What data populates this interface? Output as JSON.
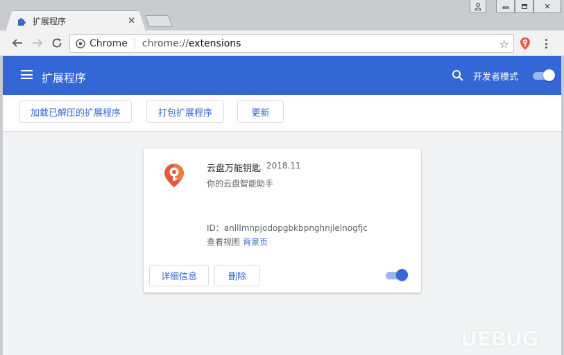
{
  "browser": {
    "tab_title": "扩展程序",
    "tab_close": "✕",
    "site_label": "Chrome",
    "url_scheme": "chrome://",
    "url_path": "extensions",
    "window_controls": {
      "minimize": "▭",
      "restore": "❐",
      "close": "✕"
    }
  },
  "header": {
    "title": "扩展程序",
    "dev_mode_label": "开发者模式",
    "dev_mode_on": true
  },
  "actions": {
    "load_unpacked": "加载已解压的扩展程序",
    "pack": "打包扩展程序",
    "update": "更新"
  },
  "extension": {
    "name": "云盘万能钥匙",
    "version": "2018.11",
    "description": "你的云盘智能助手",
    "id_label": "ID：anlllmnpjodopgbkbpnghnjlelnogfjc",
    "inspect_label": "查看视图",
    "inspect_link": "背景页",
    "details_button": "详细信息",
    "remove_button": "删除",
    "enabled": true
  },
  "colors": {
    "header_blue": "#3367d6",
    "link_blue": "#3367d6",
    "icon_red": "#e8573f",
    "icon_orange": "#f5a623"
  },
  "watermark": "UEBUG"
}
